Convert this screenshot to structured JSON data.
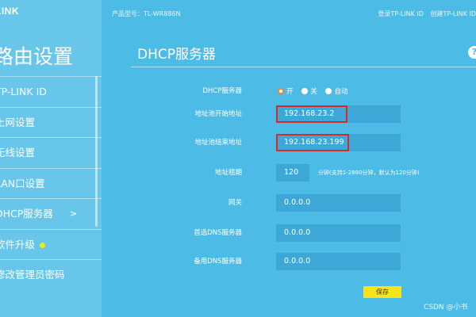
{
  "brand": "LINK",
  "sidebar": {
    "title": "路由设置",
    "items": [
      {
        "label": "TP-LINK ID"
      },
      {
        "label": "上网设置"
      },
      {
        "label": "无线设置"
      },
      {
        "label": "LAN口设置"
      },
      {
        "label": "DHCP服务器",
        "arrow": ">"
      },
      {
        "label": "软件升级"
      },
      {
        "label": "修改管理员密码"
      }
    ]
  },
  "topbar": {
    "model": "产品型号：TL-WR886N",
    "login": "登录TP-LINK ID",
    "create": "创建TP-LINK ID"
  },
  "main": {
    "title": "DHCP服务器",
    "help_icon": "?",
    "dhcp": {
      "label": "DHCP服务器",
      "options": [
        "开",
        "关",
        "自动"
      ],
      "selected": "开"
    },
    "start_addr": {
      "label": "地址池开始地址",
      "value": "192.168.23.2"
    },
    "end_addr": {
      "label": "地址池结束地址",
      "value": "192.168.23.199"
    },
    "lease": {
      "label": "地址租期",
      "value": "120",
      "hint": "分钟(支持1-2880分钟，默认为120分钟)"
    },
    "gateway": {
      "label": "网关",
      "value": "0.0.0.0"
    },
    "dns_primary": {
      "label": "首选DNS服务器",
      "value": "0.0.0.0"
    },
    "dns_secondary": {
      "label": "备用DNS服务器",
      "value": "0.0.0.0"
    },
    "save_label": "保存"
  },
  "watermark": "CSDN @小书",
  "colors": {
    "background": "#4cbbe6",
    "sidebar": "#68c6ea",
    "field": "#3da8d8",
    "highlight": "#d72b2b",
    "save": "#f5e41b"
  }
}
